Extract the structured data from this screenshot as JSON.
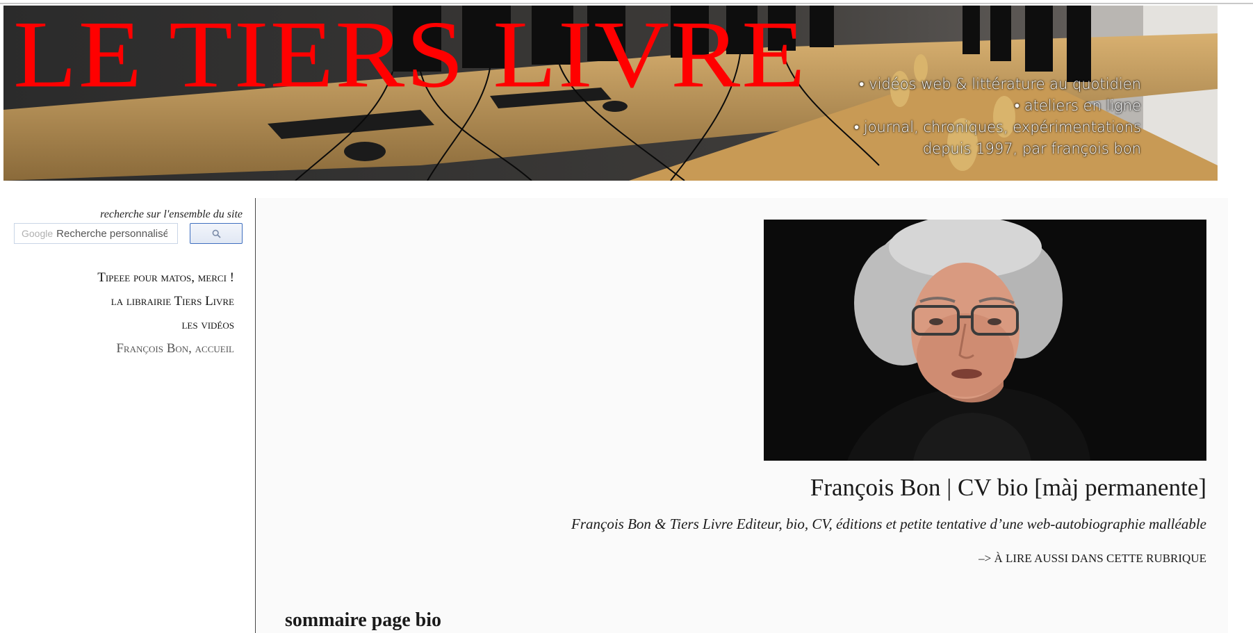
{
  "banner": {
    "title": "LE TIERS LIVRE",
    "lines": [
      "• vidéos web & littérature au quotidien",
      "• ateliers en ligne",
      "• journal, chroniques, expérimentations",
      "depuis 1997, par françois bon"
    ],
    "title_color": "#ff0000"
  },
  "sidebar": {
    "search_caption": "recherche sur l'ensemble du site",
    "google_label": "Google",
    "search_placeholder": "Recherche personnalisée",
    "search_button_icon": "search-icon",
    "nav": [
      {
        "label": "Tipeee pour matos, merci !"
      },
      {
        "label": "la librairie Tiers Livre"
      },
      {
        "label": "les vidéos"
      },
      {
        "label": "François Bon, accueil"
      }
    ]
  },
  "main": {
    "portrait_alt": "portrait photograph",
    "title": "François Bon | CV bio [màj permanente]",
    "subtitle": "François Bon & Tiers Livre Editeur, bio, CV, éditions et petite tentative d’une web-autobiographie malléable",
    "also_read": "–> À LIRE AUSSI DANS CETTE RUBRIQUE",
    "section_heading": "sommaire page bio"
  },
  "colors": {
    "accent_red": "#ff0000",
    "search_border": "#3f6fbf",
    "main_background": "#fafafa"
  }
}
